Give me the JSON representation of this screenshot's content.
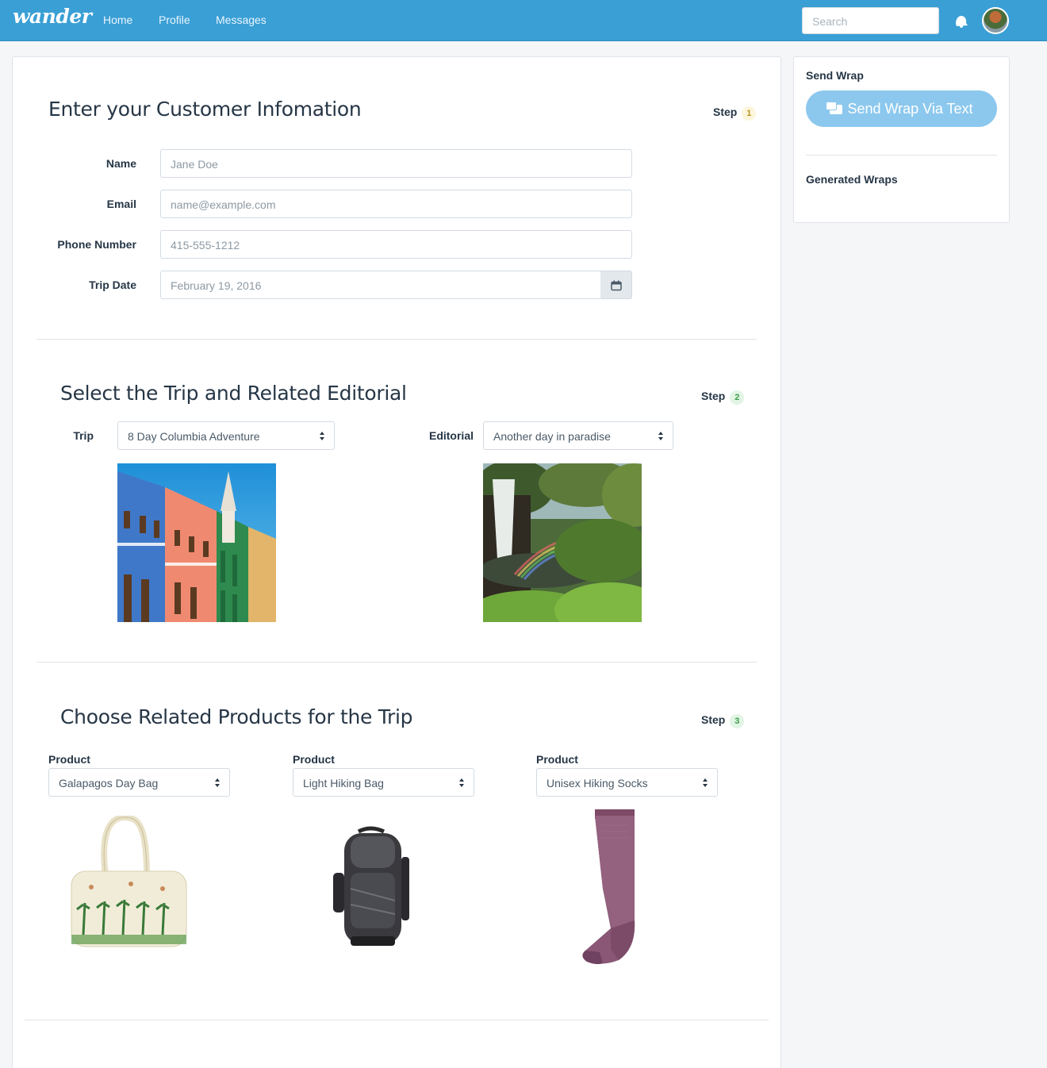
{
  "nav": {
    "brand": "wander",
    "links": [
      "Home",
      "Profile",
      "Messages"
    ],
    "search_placeholder": "Search"
  },
  "step1": {
    "title": "Enter your Customer Infomation",
    "step_label": "Step",
    "step_number": "1",
    "fields": {
      "name_label": "Name",
      "name_placeholder": "Jane Doe",
      "email_label": "Email",
      "email_placeholder": "name@example.com",
      "phone_label": "Phone Number",
      "phone_placeholder": "415-555-1212",
      "date_label": "Trip Date",
      "date_value": "February 19, 2016"
    }
  },
  "step2": {
    "title": "Select the Trip and Related Editorial",
    "step_label": "Step",
    "step_number": "2",
    "trip_label": "Trip",
    "trip_value": "8 Day Columbia Adventure",
    "editorial_label": "Editorial",
    "editorial_value": "Another day in paradise"
  },
  "step3": {
    "title": "Choose Related Products for the Trip",
    "step_label": "Step",
    "step_number": "3",
    "products": [
      {
        "label": "Product",
        "value": "Galapagos Day Bag"
      },
      {
        "label": "Product",
        "value": "Light Hiking Bag"
      },
      {
        "label": "Product",
        "value": "Unisex Hiking Socks"
      }
    ]
  },
  "sidebar": {
    "send_heading": "Send Wrap",
    "send_button": "Send Wrap Via Text",
    "generated_heading": "Generated Wraps"
  },
  "colors": {
    "navbar": "#3a9fd5",
    "send_button": "#8cc8ee",
    "step1_badge": "#fdf6dc",
    "step_badge_green": "#e2f4e4"
  }
}
